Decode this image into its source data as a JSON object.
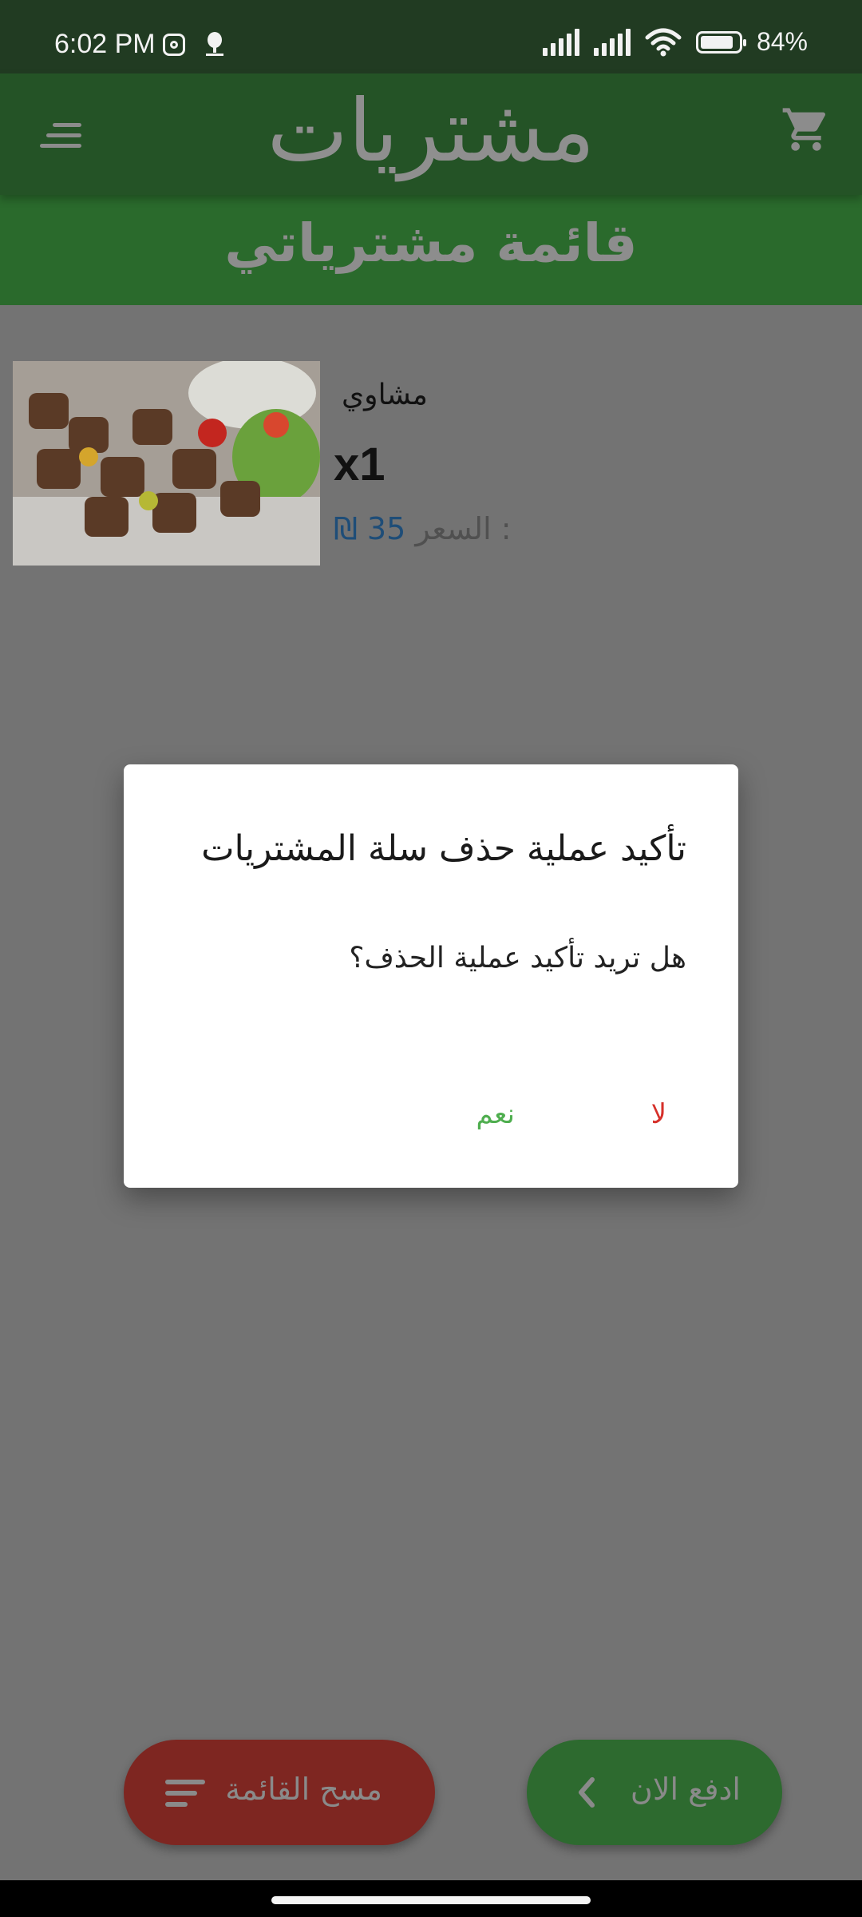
{
  "status_bar": {
    "time": "6:02 PM",
    "battery": "84%",
    "battery_level": 0.84,
    "icons": [
      "instagram-icon",
      "app-notification-icon",
      "signal-icon",
      "signal-icon",
      "wifi-icon",
      "battery-icon"
    ]
  },
  "app_bar": {
    "title": "مشتريات",
    "menu_icon": "menu-icon",
    "cart_icon": "cart-icon"
  },
  "subheader": {
    "title": "قائمة مشترياتي"
  },
  "cart_item": {
    "name": "مشاوي",
    "quantity": "x1",
    "price_label": "السعر :",
    "price_value": "35",
    "currency": "₪",
    "image_desc_icon": "food-image"
  },
  "dialog": {
    "title": "تأكيد عملية حذف سلة المشتريات",
    "message": "هل تريد تأكيد عملية الحذف؟",
    "no_label": "لا",
    "yes_label": "نعم",
    "no_color": "#d6302a",
    "yes_color": "#4fae4f"
  },
  "bottom_actions": {
    "clear_label": "مسح القائمة",
    "pay_label": "ادفع الان",
    "clear_color": "#7e2621",
    "pay_color": "#2d6a2f"
  },
  "colors": {
    "primary_dark": "#213b22",
    "primary": "#245326",
    "overlay": "#737373"
  }
}
